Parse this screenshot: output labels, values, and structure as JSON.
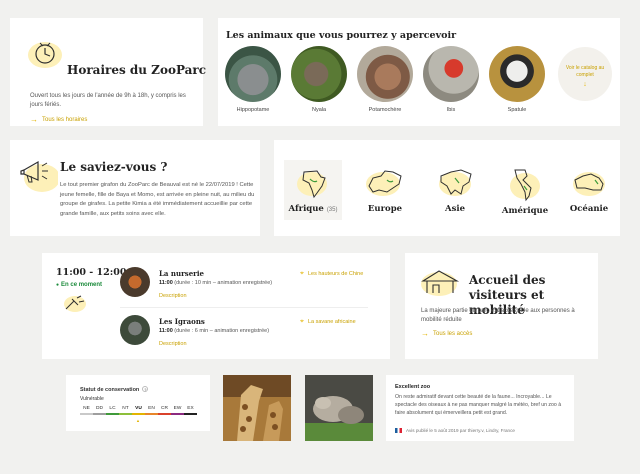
{
  "hours": {
    "title": "Horaires du ZooParc",
    "text": "Ouvert tous les jours de l'année de 9h à 18h, y compris les jours fériés.",
    "link": "Tous les horaires"
  },
  "animals": {
    "title": "Les animaux que vous pourrez y apercevoir",
    "items": [
      {
        "name": "Hippopotame",
        "icon": "hippo-photo"
      },
      {
        "name": "Nyala",
        "icon": "nyala-photo"
      },
      {
        "name": "Potamochère",
        "icon": "potamochere-photo"
      },
      {
        "name": "Ibis",
        "icon": "ibis-photo"
      },
      {
        "name": "Spatule",
        "icon": "spatule-photo"
      }
    ],
    "see_all": "Voir le catalog au complet"
  },
  "know": {
    "title": "Le saviez-vous ?",
    "text": "Le tout premier girafon du ZooParc de Beauval est né le 22/07/2019 ! Cette jeune femelle, fille de Baya et Momo, est arrivée en pleine nuit, au milieu du groupe de girafes. La petite Kimia a été immédiatement accueillie par cette grande famille, aux petits soins avec elle."
  },
  "continents": [
    {
      "name": "Afrique",
      "count": "(35)",
      "selected": true
    },
    {
      "name": "Europe",
      "count": "",
      "selected": false
    },
    {
      "name": "Asie",
      "count": "",
      "selected": false
    },
    {
      "name": "Amérique",
      "count": "",
      "selected": false
    },
    {
      "name": "Océanie",
      "count": "",
      "selected": false
    }
  ],
  "schedule": {
    "time": "11:00 - 12:00",
    "now": "En ce moment",
    "events": [
      {
        "title": "La nurserie",
        "duration_label": "11:00",
        "duration": "(durée : 10 min – animation enregistrée)",
        "description": "Description",
        "location": "Les hauteurs de Chine"
      },
      {
        "title": "Les Igraons",
        "duration_label": "11:00",
        "duration": "(durée : 6 min – animation enregistrée)",
        "description": "Description",
        "location": "La savane africaine"
      }
    ]
  },
  "welcome": {
    "title": "Accueil des visiteurs et mobilité",
    "text": "La majeure partie du parc est accessible aux personnes à mobilité réduite",
    "link": "Tous les accès"
  },
  "conservation": {
    "title": "Statut de conservation",
    "info": "?",
    "current": "Vulnérable",
    "statuses": [
      {
        "code": "NE",
        "color": "#c9c9c9"
      },
      {
        "code": "DD",
        "color": "#9e9e9e"
      },
      {
        "code": "LC",
        "color": "#3f9a3a"
      },
      {
        "code": "NT",
        "color": "#8dbf3a"
      },
      {
        "code": "VU",
        "color": "#e3b400"
      },
      {
        "code": "EN",
        "color": "#e8862a"
      },
      {
        "code": "CR",
        "color": "#d9412b"
      },
      {
        "code": "EW",
        "color": "#8c2a80"
      },
      {
        "code": "EX",
        "color": "#222222"
      }
    ]
  },
  "review": {
    "title": "Excellent zoo",
    "text": "On reste admiratif devant cette beauté de la faune... Incroyable... Le spectacle des oiseaux à ne pas manquer malgré la météo, bref un zoo à faire absolument qui émerveillera petit est grand.",
    "meta": "Avis publié le 5 août 2019 par thierry.v, Lindry, France"
  },
  "colors": {
    "accent": "#e3b400",
    "background": "#f1f1ef",
    "green": "#1a8a3a"
  }
}
